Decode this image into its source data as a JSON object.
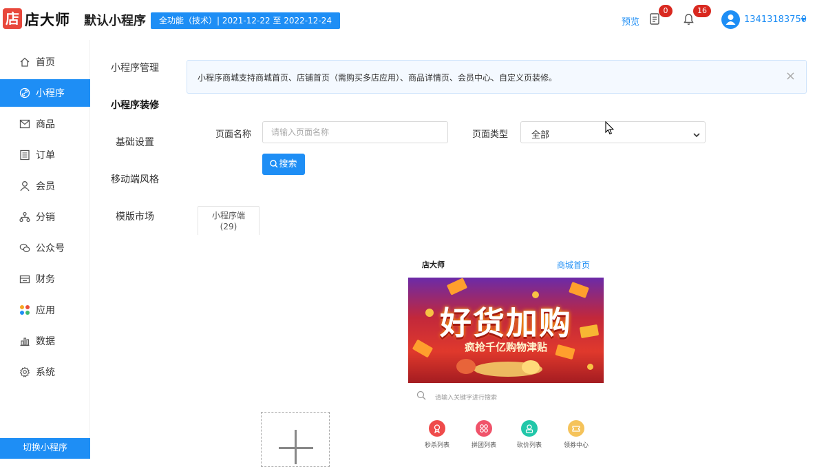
{
  "header": {
    "logo_glyph": "店",
    "brand": "店大师",
    "app_title": "默认小程序",
    "plan_badge": "全功能（技术）| 2021-12-22 至 2022-12-24",
    "preview_label": "预览",
    "orders_badge": "0",
    "notifications_badge": "16",
    "user_phone": "13413183750"
  },
  "sidebar": {
    "items": [
      {
        "label": "首页",
        "icon": "home-icon"
      },
      {
        "label": "小程序",
        "icon": "link-icon"
      },
      {
        "label": "商品",
        "icon": "envelope-icon"
      },
      {
        "label": "订单",
        "icon": "list-icon"
      },
      {
        "label": "会员",
        "icon": "user-icon"
      },
      {
        "label": "分销",
        "icon": "network-icon"
      },
      {
        "label": "公众号",
        "icon": "wechat-icon"
      },
      {
        "label": "财务",
        "icon": "wallet-icon"
      },
      {
        "label": "应用",
        "icon": "apps-icon"
      },
      {
        "label": "数据",
        "icon": "bar-chart-icon"
      },
      {
        "label": "系统",
        "icon": "gear-icon"
      }
    ],
    "active_index": 1,
    "switch_button": "切换小程序"
  },
  "subnav": {
    "items": [
      "小程序管理",
      "小程序装修",
      "基础设置",
      "移动端风格",
      "模版市场"
    ],
    "active_index": 1
  },
  "notice": {
    "text": "小程序商城支持商城首页、店铺首页（需购买多店应用）、商品详情页、会员中心、自定义页装修。",
    "close": "×"
  },
  "form": {
    "page_name_label": "页面名称",
    "page_name_placeholder": "请输入页面名称",
    "page_type_label": "页面类型",
    "page_type_value": "全部",
    "search_button": "搜索"
  },
  "tabs": [
    {
      "label": "小程序端",
      "count": "(29)"
    }
  ],
  "preview": {
    "shop_name": "店大师",
    "page_link": "商城首页",
    "banner_title": "好货加购",
    "banner_subtitle": "疯抢千亿购物津贴",
    "search_placeholder": "请输入关键字进行搜索",
    "categories": [
      {
        "label": "秒杀列表",
        "color": "#ef4b4b"
      },
      {
        "label": "拼团列表",
        "color": "#f0536a"
      },
      {
        "label": "砍价列表",
        "color": "#22c7a9"
      },
      {
        "label": "领券中心",
        "color": "#f5c35a"
      }
    ]
  },
  "colors": {
    "primary": "#1e8ef5",
    "danger": "#d9281f",
    "logo": "#e8473b"
  }
}
